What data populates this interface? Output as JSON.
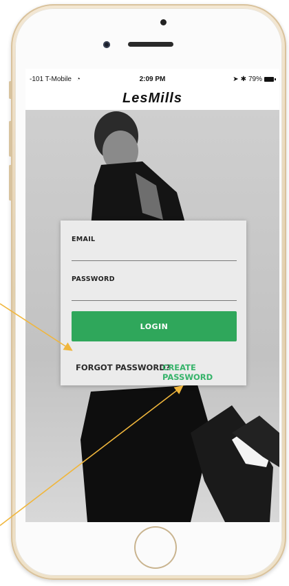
{
  "status_bar": {
    "carrier": "-101 T-Mobile",
    "time": "2:09 PM",
    "battery": "79%"
  },
  "app": {
    "logo": "LesMills"
  },
  "login_form": {
    "email_label": "EMAIL",
    "email_value": "",
    "password_label": "PASSWORD",
    "password_value": "",
    "login_button": "LOGIN",
    "forgot_password": "FORGOT PASSWORD?",
    "create_password": "CREATE PASSWORD"
  },
  "icons": {
    "wifi": "wifi-icon",
    "location": "location-icon",
    "bluetooth": "bluetooth-icon",
    "battery": "battery-icon"
  },
  "colors": {
    "primary_green": "#2fa75b",
    "link_green": "#36b36a",
    "annotation_arrow": "#f0b63c"
  }
}
